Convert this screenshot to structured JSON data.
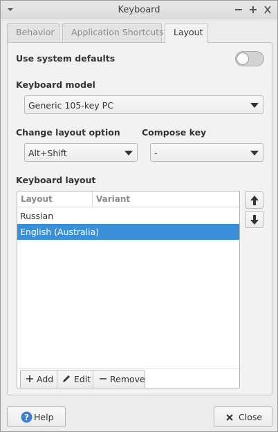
{
  "window": {
    "title": "Keyboard"
  },
  "tabs": [
    {
      "label": "Behavior",
      "active": false
    },
    {
      "label": "Application Shortcuts",
      "active": false
    },
    {
      "label": "Layout",
      "active": true
    }
  ],
  "system_defaults": {
    "label": "Use system defaults",
    "enabled": false
  },
  "keyboard_model": {
    "label": "Keyboard model",
    "value": "Generic 105-key PC"
  },
  "change_layout": {
    "label": "Change layout option",
    "value": "Alt+Shift"
  },
  "compose_key": {
    "label": "Compose key",
    "value": "-"
  },
  "keyboard_layout": {
    "label": "Keyboard layout",
    "columns": [
      "Layout",
      "Variant"
    ],
    "rows": [
      {
        "layout": "Russian",
        "variant": "",
        "selected": false
      },
      {
        "layout": "English (Australia)",
        "variant": "",
        "selected": true
      }
    ],
    "toolbar": {
      "add": "Add",
      "edit": "Edit",
      "remove": "Remove"
    }
  },
  "footer": {
    "help": "Help",
    "close": "Close"
  },
  "colors": {
    "selection": "#3a8fd9",
    "help_icon": "#3d7fd0"
  }
}
